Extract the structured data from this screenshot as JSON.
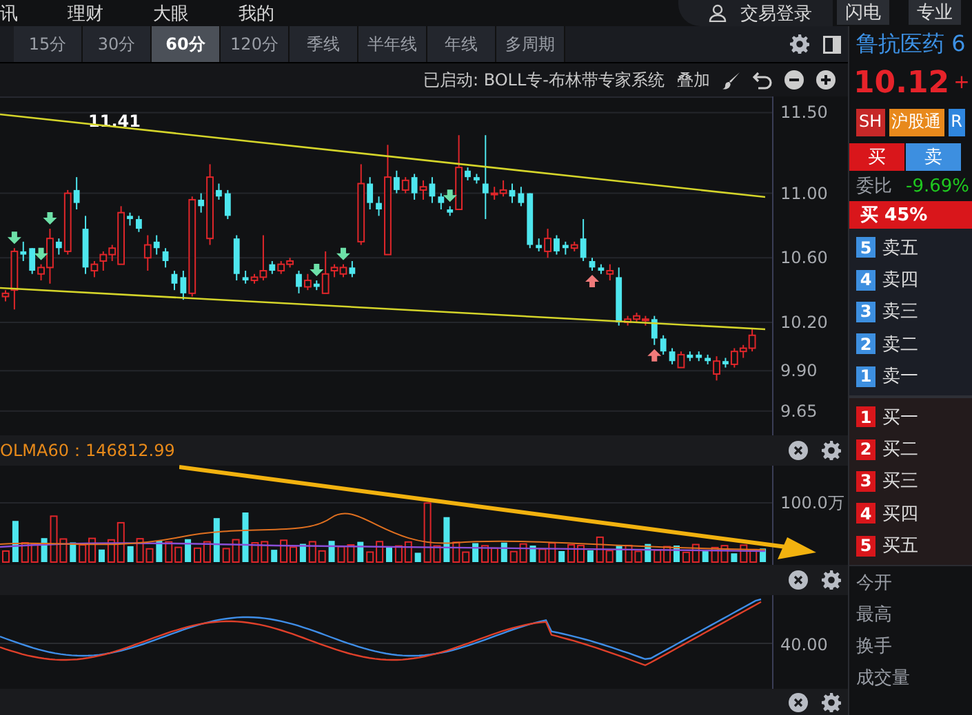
{
  "top_menu": {
    "items": [
      "讯",
      "理财",
      "大眼",
      "我的"
    ],
    "login": "交易登录",
    "modes": [
      "闪电",
      "专业"
    ]
  },
  "period_tabs": [
    {
      "label": "15分",
      "selected": false
    },
    {
      "label": "30分",
      "selected": false
    },
    {
      "label": "60分",
      "selected": true
    },
    {
      "label": "120分",
      "selected": false
    },
    {
      "label": "季线",
      "selected": false
    },
    {
      "label": "半年线",
      "selected": false
    },
    {
      "label": "年线",
      "selected": false
    },
    {
      "label": "多周期",
      "selected": false
    }
  ],
  "chart": {
    "indicator_status": "已启动: BOLL专-布林带专家系统",
    "overlay_button": "叠加",
    "high_label": "11.41",
    "chart_data": {
      "type": "candlestick",
      "yticks": [
        {
          "value": 11.5,
          "label": "11.50"
        },
        {
          "value": 11.0,
          "label": "11.00"
        },
        {
          "value": 10.6,
          "label": "10.60"
        },
        {
          "value": 10.2,
          "label": "10.20"
        },
        {
          "value": 9.9,
          "label": "9.90"
        },
        {
          "value": 9.65,
          "label": "9.65"
        }
      ],
      "ylim": [
        9.5,
        11.6
      ],
      "grid": true,
      "ohlc": [
        [
          10.36,
          10.4,
          10.33,
          10.38
        ],
        [
          10.4,
          10.66,
          10.28,
          10.64
        ],
        [
          10.64,
          10.7,
          10.58,
          10.62
        ],
        [
          10.66,
          10.66,
          10.5,
          10.52
        ],
        [
          10.5,
          10.56,
          10.46,
          10.54
        ],
        [
          10.54,
          10.78,
          10.44,
          10.72
        ],
        [
          10.7,
          10.72,
          10.62,
          10.66
        ],
        [
          10.64,
          11.02,
          10.62,
          11.0
        ],
        [
          11.02,
          11.1,
          10.9,
          10.94
        ],
        [
          10.78,
          10.86,
          10.5,
          10.54
        ],
        [
          10.52,
          10.58,
          10.48,
          10.56
        ],
        [
          10.58,
          10.64,
          10.52,
          10.62
        ],
        [
          10.62,
          10.68,
          10.58,
          10.66
        ],
        [
          10.56,
          10.92,
          10.56,
          10.88
        ],
        [
          10.86,
          10.88,
          10.8,
          10.84
        ],
        [
          10.84,
          10.86,
          10.76,
          10.78
        ],
        [
          10.6,
          10.74,
          10.52,
          10.68
        ],
        [
          10.7,
          10.74,
          10.62,
          10.66
        ],
        [
          10.64,
          10.66,
          10.54,
          10.58
        ],
        [
          10.5,
          10.52,
          10.4,
          10.44
        ],
        [
          10.48,
          10.52,
          10.34,
          10.38
        ],
        [
          10.38,
          10.98,
          10.36,
          10.96
        ],
        [
          10.96,
          11.0,
          10.88,
          10.92
        ],
        [
          10.72,
          11.18,
          10.68,
          11.1
        ],
        [
          11.02,
          11.06,
          10.96,
          10.98
        ],
        [
          11.0,
          11.02,
          10.84,
          10.86
        ],
        [
          10.72,
          10.74,
          10.46,
          10.5
        ],
        [
          10.48,
          10.52,
          10.44,
          10.46
        ],
        [
          10.46,
          10.5,
          10.44,
          10.48
        ],
        [
          10.48,
          10.74,
          10.46,
          10.52
        ],
        [
          10.56,
          10.58,
          10.5,
          10.52
        ],
        [
          10.52,
          10.58,
          10.5,
          10.56
        ],
        [
          10.56,
          10.6,
          10.54,
          10.58
        ],
        [
          10.5,
          10.52,
          10.38,
          10.42
        ],
        [
          10.42,
          10.5,
          10.4,
          10.46
        ],
        [
          10.44,
          10.46,
          10.4,
          10.42
        ],
        [
          10.38,
          10.64,
          10.38,
          10.5
        ],
        [
          10.52,
          10.56,
          10.48,
          10.54
        ],
        [
          10.5,
          10.56,
          10.48,
          10.54
        ],
        [
          10.54,
          10.58,
          10.48,
          10.5
        ],
        [
          10.7,
          11.18,
          10.68,
          11.06
        ],
        [
          11.06,
          11.1,
          10.9,
          10.94
        ],
        [
          10.94,
          10.98,
          10.86,
          10.9
        ],
        [
          10.62,
          11.3,
          10.62,
          11.1
        ],
        [
          11.1,
          11.14,
          11.0,
          11.02
        ],
        [
          11.02,
          11.1,
          11.0,
          11.08
        ],
        [
          11.1,
          11.12,
          10.96,
          11.0
        ],
        [
          11.02,
          11.08,
          10.96,
          11.04
        ],
        [
          11.06,
          11.1,
          10.94,
          10.98
        ],
        [
          10.98,
          11.0,
          10.9,
          10.94
        ],
        [
          10.9,
          10.92,
          10.86,
          10.88
        ],
        [
          10.9,
          11.36,
          10.9,
          11.16
        ],
        [
          11.14,
          11.16,
          11.08,
          11.1
        ],
        [
          11.1,
          11.12,
          11.06,
          11.08
        ],
        [
          11.06,
          11.36,
          10.84,
          11.0
        ],
        [
          11.0,
          11.04,
          10.96,
          11.0
        ],
        [
          11.0,
          11.08,
          10.98,
          11.02
        ],
        [
          11.02,
          11.06,
          10.94,
          10.98
        ],
        [
          11.0,
          11.04,
          10.92,
          10.94
        ],
        [
          11.0,
          11.0,
          10.66,
          10.68
        ],
        [
          10.68,
          10.72,
          10.64,
          10.66
        ],
        [
          10.64,
          10.78,
          10.6,
          10.72
        ],
        [
          10.72,
          10.74,
          10.62,
          10.64
        ],
        [
          10.68,
          10.7,
          10.62,
          10.66
        ],
        [
          10.66,
          10.7,
          10.64,
          10.68
        ],
        [
          10.72,
          10.84,
          10.58,
          10.6
        ],
        [
          10.58,
          10.6,
          10.52,
          10.54
        ],
        [
          10.54,
          10.56,
          10.5,
          10.52
        ],
        [
          10.5,
          10.56,
          10.46,
          10.52
        ],
        [
          10.48,
          10.54,
          10.18,
          10.2
        ],
        [
          10.2,
          10.24,
          10.18,
          10.22
        ],
        [
          10.22,
          10.26,
          10.2,
          10.24
        ],
        [
          10.22,
          10.24,
          10.18,
          10.22
        ],
        [
          10.22,
          10.24,
          10.06,
          10.1
        ],
        [
          10.1,
          10.12,
          10.0,
          10.02
        ],
        [
          10.02,
          10.04,
          9.94,
          9.96
        ],
        [
          9.92,
          10.02,
          9.92,
          10.0
        ],
        [
          10.0,
          10.02,
          9.96,
          9.98
        ],
        [
          10.0,
          10.02,
          9.96,
          9.98
        ],
        [
          9.98,
          10.0,
          9.94,
          9.96
        ],
        [
          9.88,
          9.99,
          9.84,
          9.96
        ],
        [
          9.96,
          9.98,
          9.92,
          9.94
        ],
        [
          9.94,
          10.04,
          9.92,
          10.02
        ],
        [
          10.02,
          10.06,
          9.98,
          10.04
        ],
        [
          10.04,
          10.16,
          10.02,
          10.12
        ]
      ]
    },
    "volume_header": "OLMA60：146812.99",
    "volume_axis": [
      "100.0万"
    ],
    "oscillator_axis": [
      "40.00"
    ]
  },
  "quote": {
    "name": "鲁抗医药 6",
    "price": "10.12",
    "change": "+",
    "tags": [
      {
        "text": "SH",
        "color": "#c62828"
      },
      {
        "text": "沪股通",
        "color": "#e8891c"
      },
      {
        "text": "R",
        "color": "#2f86de"
      }
    ],
    "trade_buttons": [
      {
        "label": "买",
        "kind": "buy"
      },
      {
        "label": "卖",
        "kind": "sell"
      }
    ],
    "ratio_label": "委比",
    "ratio_value": "-9.69%",
    "buy_share": "买 45%",
    "asks": [
      {
        "index": "5",
        "label": "卖五"
      },
      {
        "index": "4",
        "label": "卖四"
      },
      {
        "index": "3",
        "label": "卖三"
      },
      {
        "index": "2",
        "label": "卖二"
      },
      {
        "index": "1",
        "label": "卖一"
      }
    ],
    "bids": [
      {
        "index": "1",
        "label": "买一"
      },
      {
        "index": "2",
        "label": "买二"
      },
      {
        "index": "3",
        "label": "买三"
      },
      {
        "index": "4",
        "label": "买四"
      },
      {
        "index": "5",
        "label": "买五"
      }
    ],
    "stats": [
      "今开",
      "最高",
      "换手",
      "成交量"
    ]
  }
}
